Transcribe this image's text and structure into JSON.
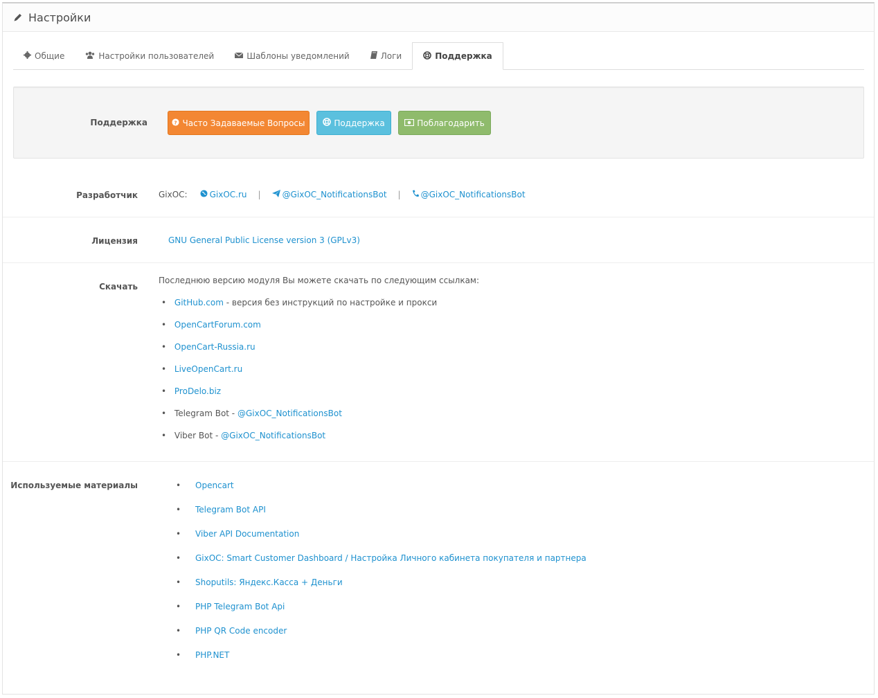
{
  "header": {
    "title": "Настройки",
    "icon": "pencil-icon"
  },
  "tabs": [
    {
      "label": "Общие",
      "icon": "gear-icon"
    },
    {
      "label": "Настройки пользователей",
      "icon": "users-icon"
    },
    {
      "label": "Шаблоны уведомлений",
      "icon": "envelope-icon"
    },
    {
      "label": "Логи",
      "icon": "book-icon"
    },
    {
      "label": "Поддержка",
      "icon": "lifebuoy-icon",
      "active": true
    }
  ],
  "support": {
    "label": "Поддержка",
    "faq_button": "Часто Задаваемые Вопросы",
    "support_button": "Поддержка",
    "thanks_button": "Поблагодарить",
    "colors": {
      "faq": "#f38733",
      "support": "#5bc0de",
      "thanks": "#8fbb6c"
    }
  },
  "developer": {
    "label": "Разработчик",
    "name": "GixOC:",
    "site": "GixOC.ru",
    "telegram": "@GixOC_NotificationsBot",
    "viber": "@GixOC_NotificationsBot",
    "separator": "|"
  },
  "license": {
    "label": "Лицензия",
    "text": "GNU General Public License version 3 (GPLv3)"
  },
  "download": {
    "label": "Скачать",
    "intro": "Последнюю версию модуля Вы можете скачать по следующим ссылкам:",
    "links": [
      {
        "link": "GitHub.com",
        "suffix": " - версия без инструкций по настройке и прокси"
      },
      {
        "link": "OpenCartForum.com"
      },
      {
        "link": "OpenCart-Russia.ru"
      },
      {
        "link": "LiveOpenCart.ru"
      },
      {
        "link": "ProDelo.biz"
      },
      {
        "prefix": "Telegram Bot - ",
        "link": "@GixOC_NotificationsBot"
      },
      {
        "prefix": "Viber Bot - ",
        "link": "@GixOC_NotificationsBot"
      }
    ]
  },
  "materials": {
    "label": "Используемые материалы",
    "items": [
      "Opencart",
      "Telegram Bot API",
      "Viber API Documentation",
      "GixOC: Smart Customer Dashboard / Настройка Личного кабинета покупателя и партнера",
      "Shoputils: Яндекс.Касса + Деньги",
      "PHP Telegram Bot Api",
      "PHP QR Code encoder",
      "PHP.NET"
    ]
  },
  "link_color": "#1e91cf"
}
